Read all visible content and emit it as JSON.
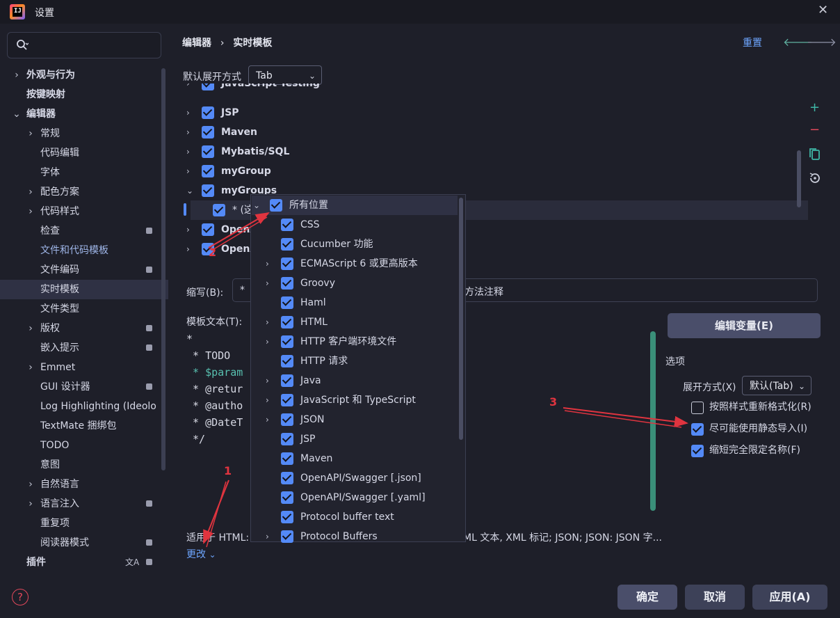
{
  "window": {
    "title": "设置",
    "close_icon": "close-icon"
  },
  "sidebar": {
    "search_placeholder": "",
    "items": [
      {
        "label": "外观与行为",
        "arrow": "›",
        "bold": true
      },
      {
        "label": "按键映射",
        "bold": true
      },
      {
        "label": "编辑器",
        "arrow": "⌄",
        "bold": true
      },
      {
        "label": "常规",
        "arrow": "›"
      },
      {
        "label": "代码编辑"
      },
      {
        "label": "字体"
      },
      {
        "label": "配色方案",
        "arrow": "›"
      },
      {
        "label": "代码样式",
        "arrow": "›"
      },
      {
        "label": "检查",
        "badge": true
      },
      {
        "label": "文件和代码模板",
        "accent": true
      },
      {
        "label": "文件编码",
        "badge": true
      },
      {
        "label": "实时模板",
        "selected": true
      },
      {
        "label": "文件类型"
      },
      {
        "label": "版权",
        "arrow": "›",
        "badge": true
      },
      {
        "label": "嵌入提示",
        "badge": true
      },
      {
        "label": "Emmet",
        "arrow": "›"
      },
      {
        "label": "GUI 设计器",
        "badge": true
      },
      {
        "label": "Log Highlighting (Ideolo"
      },
      {
        "label": "TextMate 捆绑包"
      },
      {
        "label": "TODO"
      },
      {
        "label": "意图"
      },
      {
        "label": "自然语言",
        "arrow": "›"
      },
      {
        "label": "语言注入",
        "arrow": "›",
        "badge": true
      },
      {
        "label": "重复项"
      },
      {
        "label": "阅读器模式",
        "badge": true
      },
      {
        "label": "插件",
        "bold": true,
        "badge": true
      }
    ]
  },
  "header": {
    "breadcrumb": [
      "编辑器",
      "›",
      "实时模板"
    ],
    "reset_label": "重置",
    "back_color": "#5fb0a0",
    "forward_color": "#8f93a6"
  },
  "expand_mode": {
    "label": "默认展开方式",
    "value": "Tab"
  },
  "template_groups": [
    {
      "name": "JavaScript Testing",
      "partial": true
    },
    {
      "name": "JSP"
    },
    {
      "name": "Maven"
    },
    {
      "name": "Mybatis/SQL"
    },
    {
      "name": "myGroup"
    },
    {
      "name": "myGroups",
      "expanded": true
    },
    {
      "name": "* (这",
      "child": true
    },
    {
      "name": "OpenA"
    },
    {
      "name": "OpenA"
    }
  ],
  "abbrev": {
    "label": "缩写(B):",
    "value": "*",
    "description_tail": "方法注释"
  },
  "template_text": {
    "label": "模板文本(T):",
    "lines": [
      "*",
      " * TODO",
      " * $param",
      " * @retur",
      " * @autho",
      " * @DateT",
      " */"
    ]
  },
  "edit_vars_button": "编辑变量(E)",
  "options": {
    "title": "选项",
    "expand_label": "展开方式(X)",
    "expand_value": "默认(Tab)",
    "checks": [
      {
        "label": "按照样式重新格式化(R)",
        "checked": false
      },
      {
        "label": "尽可能使用静态导入(I)",
        "checked": true
      },
      {
        "label": "缩短完全限定名称(F)",
        "checked": true
      }
    ]
  },
  "applicable": {
    "prefix": "适用于 HTML:",
    "tail": "ML 文本, XML 标记; JSON; JSON: JSON 字...",
    "change_label": "更改"
  },
  "context_popup": {
    "items": [
      {
        "label": "所有位置",
        "arrow": "⌄",
        "header": true
      },
      {
        "label": "CSS"
      },
      {
        "label": "Cucumber 功能"
      },
      {
        "label": "ECMAScript 6 或更高版本",
        "arrow": "›"
      },
      {
        "label": "Groovy",
        "arrow": "›"
      },
      {
        "label": "Haml"
      },
      {
        "label": "HTML",
        "arrow": "›"
      },
      {
        "label": "HTTP 客户端环境文件",
        "arrow": "›"
      },
      {
        "label": "HTTP 请求"
      },
      {
        "label": "Java",
        "arrow": "›"
      },
      {
        "label": "JavaScript 和 TypeScript",
        "arrow": "›"
      },
      {
        "label": "JSON",
        "arrow": "›"
      },
      {
        "label": "JSP"
      },
      {
        "label": "Maven"
      },
      {
        "label": "OpenAPI/Swagger [.json]"
      },
      {
        "label": "OpenAPI/Swagger [.yaml]"
      },
      {
        "label": "Protocol buffer text"
      },
      {
        "label": "Protocol Buffers",
        "arrow": "›"
      }
    ]
  },
  "annotations": [
    "1",
    "2",
    "3"
  ],
  "footer": {
    "ok": "确定",
    "cancel": "取消",
    "apply": "应用(A)"
  },
  "colors": {
    "accent": "#548af7",
    "link": "#6ea6ff",
    "annotation": "#e0343f",
    "selection": "#2f3144"
  }
}
